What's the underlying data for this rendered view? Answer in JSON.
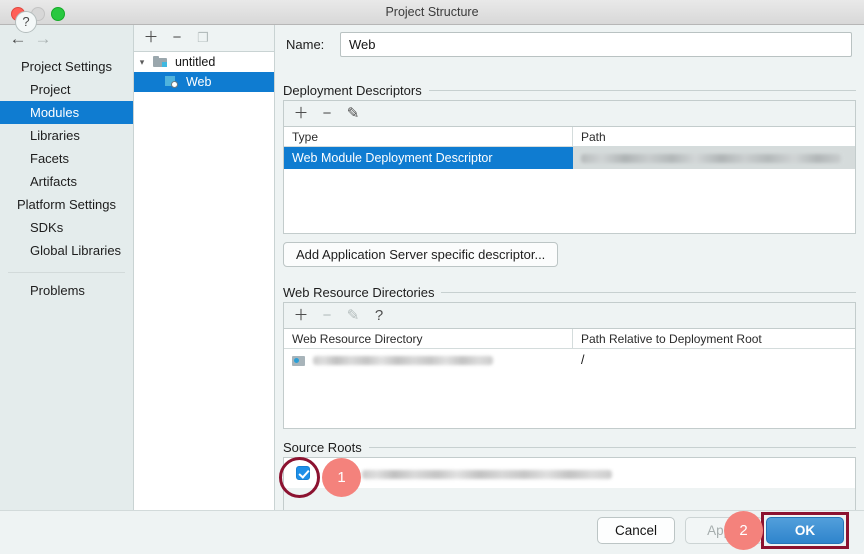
{
  "window": {
    "title": "Project Structure",
    "controls": [
      "close",
      "minimize",
      "zoom"
    ]
  },
  "sidebar": {
    "nav": {
      "back": "←",
      "forward": "→"
    },
    "items": [
      {
        "label": "Project Settings",
        "type": "group",
        "selected": false
      },
      {
        "label": "Project",
        "type": "child",
        "selected": false
      },
      {
        "label": "Modules",
        "type": "child",
        "selected": true
      },
      {
        "label": "Libraries",
        "type": "child",
        "selected": false
      },
      {
        "label": "Facets",
        "type": "child",
        "selected": false
      },
      {
        "label": "Artifacts",
        "type": "child",
        "selected": false
      },
      {
        "label": "Platform Settings",
        "type": "group",
        "selected": false
      },
      {
        "label": "SDKs",
        "type": "child",
        "selected": false
      },
      {
        "label": "Global Libraries",
        "type": "child",
        "selected": false
      }
    ],
    "footer_item": {
      "label": "Problems"
    }
  },
  "tree": {
    "toolbar": [
      {
        "name": "add",
        "glyph": "＋",
        "enabled": true
      },
      {
        "name": "remove",
        "glyph": "−",
        "enabled": true
      },
      {
        "name": "copy",
        "glyph": "❐",
        "enabled": false
      }
    ],
    "nodes": [
      {
        "label": "untitled",
        "icon": "folder-module-icon",
        "expanded": true,
        "selected": false,
        "depth": 0
      },
      {
        "label": "Web",
        "icon": "web-module-icon",
        "expanded": false,
        "selected": true,
        "depth": 1
      }
    ]
  },
  "main": {
    "name_field": {
      "label": "Name:",
      "value": "Web",
      "placeholder": ""
    },
    "deployment": {
      "title": "Deployment Descriptors",
      "toolbar": [
        {
          "name": "add",
          "glyph": "＋",
          "enabled": true
        },
        {
          "name": "remove",
          "glyph": "−",
          "enabled": true
        },
        {
          "name": "edit",
          "glyph": "✎",
          "enabled": true
        }
      ],
      "columns": [
        "Type",
        "Path"
      ],
      "rows": [
        {
          "type": "Web Module Deployment Descriptor",
          "path": "",
          "path_redacted": true,
          "selected": true
        }
      ],
      "add_server_button": "Add Application Server specific descriptor..."
    },
    "web_resources": {
      "title": "Web Resource Directories",
      "toolbar": [
        {
          "name": "add",
          "glyph": "＋",
          "enabled": true
        },
        {
          "name": "remove",
          "glyph": "−",
          "enabled": false
        },
        {
          "name": "edit",
          "glyph": "✎",
          "enabled": false
        },
        {
          "name": "help",
          "glyph": "?",
          "enabled": true
        }
      ],
      "columns": [
        "Web Resource Directory",
        "Path Relative to Deployment Root"
      ],
      "rows": [
        {
          "directory": "",
          "directory_redacted": true,
          "relative_path": "/"
        }
      ]
    },
    "source_roots": {
      "title": "Source Roots",
      "rows": [
        {
          "checked": true,
          "path": "",
          "path_redacted": true
        }
      ]
    }
  },
  "footer": {
    "help_label": "?",
    "cancel_label": "Cancel",
    "apply_label": "Apply",
    "ok_label": "OK"
  },
  "annotations": [
    {
      "id": "1",
      "target": "source-root-checkbox"
    },
    {
      "id": "2",
      "target": "ok-button"
    }
  ],
  "colors": {
    "selection_blue": "#0f7cd1",
    "ok_button_blue": "#3b8ed2",
    "annotation_ring": "#8c1230",
    "annotation_badge": "#f4827c",
    "panel_bg": "#eef3f3",
    "sidebar_bg": "#e4ecec"
  }
}
